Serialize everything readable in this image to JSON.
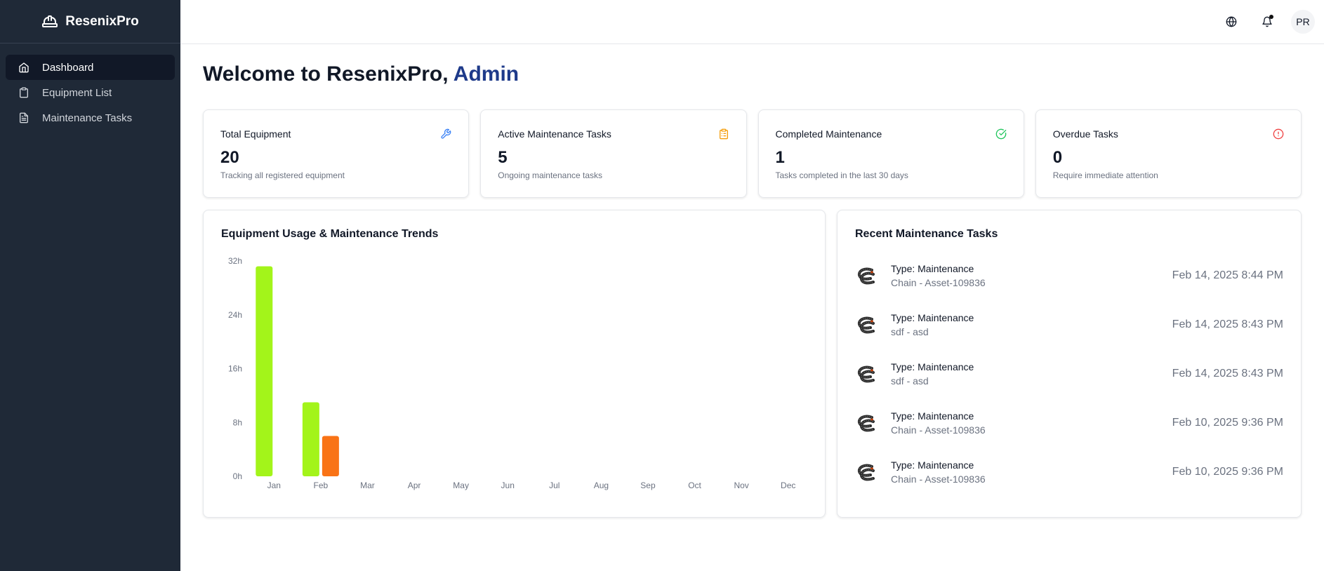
{
  "app": {
    "name": "ResenixPro",
    "logo_icon": "hard-hat-icon"
  },
  "sidebar": {
    "items": [
      {
        "label": "Dashboard",
        "icon": "home-icon",
        "active": true
      },
      {
        "label": "Equipment List",
        "icon": "clipboard-icon",
        "active": false
      },
      {
        "label": "Maintenance Tasks",
        "icon": "document-icon",
        "active": false
      }
    ]
  },
  "header": {
    "avatar_initials": "PR",
    "notification_dot": true
  },
  "welcome": {
    "prefix": "Welcome to ResenixPro, ",
    "user": "Admin"
  },
  "cards": [
    {
      "title": "Total Equipment",
      "value": "20",
      "subtitle": "Tracking all registered equipment",
      "icon": "wrench-icon",
      "color": "#3b82f6"
    },
    {
      "title": "Active Maintenance Tasks",
      "value": "5",
      "subtitle": "Ongoing maintenance tasks",
      "icon": "clipboard-icon",
      "color": "#f59e0b"
    },
    {
      "title": "Completed Maintenance",
      "value": "1",
      "subtitle": "Tasks completed in the last 30 days",
      "icon": "check-circle-icon",
      "color": "#22c55e"
    },
    {
      "title": "Overdue Tasks",
      "value": "0",
      "subtitle": "Require immediate attention",
      "icon": "alert-circle-icon",
      "color": "#ef4444"
    }
  ],
  "chart_panel": {
    "title": "Equipment Usage & Maintenance Trends"
  },
  "chart_data": {
    "type": "bar",
    "title": "Equipment Usage & Maintenance Trends",
    "categories": [
      "Jan",
      "Feb",
      "Mar",
      "Apr",
      "May",
      "Jun",
      "Jul",
      "Aug",
      "Sep",
      "Oct",
      "Nov",
      "Dec"
    ],
    "series": [
      {
        "values": [
          31.2,
          11,
          0,
          0,
          0,
          0,
          0,
          0,
          0,
          0,
          0,
          0
        ],
        "color": "#a3f41a"
      },
      {
        "values": [
          0,
          6,
          0,
          0,
          0,
          0,
          0,
          0,
          0,
          0,
          0,
          0
        ],
        "color": "#f97316"
      }
    ],
    "yticks": [
      "0h",
      "8h",
      "16h",
      "24h",
      "32h"
    ],
    "ylim": [
      0,
      32
    ],
    "grid": false
  },
  "tasks_panel": {
    "title": "Recent Maintenance Tasks",
    "tasks": [
      {
        "type": "Type: Maintenance",
        "asset": "Chain - Asset-109836",
        "date": "Feb 14, 2025 8:44 PM"
      },
      {
        "type": "Type: Maintenance",
        "asset": "sdf - asd",
        "date": "Feb 14, 2025 8:43 PM"
      },
      {
        "type": "Type: Maintenance",
        "asset": "sdf - asd",
        "date": "Feb 14, 2025 8:43 PM"
      },
      {
        "type": "Type: Maintenance",
        "asset": "Chain - Asset-109836",
        "date": "Feb 10, 2025 9:36 PM"
      },
      {
        "type": "Type: Maintenance",
        "asset": "Chain - Asset-109836",
        "date": "Feb 10, 2025 9:36 PM"
      }
    ]
  }
}
